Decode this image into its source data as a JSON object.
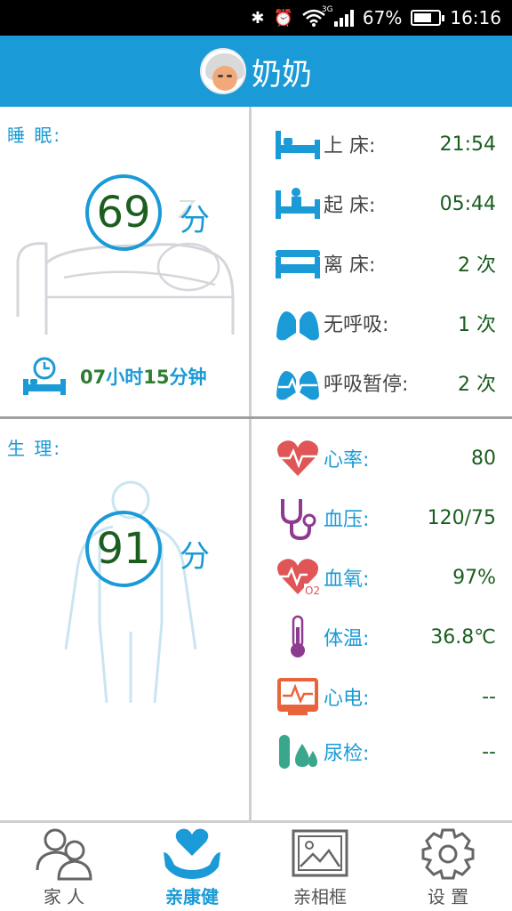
{
  "status_bar": {
    "battery": "67%",
    "time": "16:16",
    "network": "3G"
  },
  "header": {
    "title": "奶奶"
  },
  "sleep": {
    "label": "睡 眠:",
    "score": "69",
    "score_unit": "分",
    "total_hours": "07",
    "hours_unit": "小时",
    "total_minutes": "15",
    "minutes_unit": "分钟"
  },
  "sleep_stats": [
    {
      "icon": "bed-icon",
      "label": "上 床:",
      "value": "21:54",
      "unit": ""
    },
    {
      "icon": "get-up-icon",
      "label": "起 床:",
      "value": "05:44",
      "unit": ""
    },
    {
      "icon": "leave-bed-icon",
      "label": "离 床:",
      "value": "2",
      "unit": "次"
    },
    {
      "icon": "lungs-icon",
      "label": "无呼吸:",
      "value": "1",
      "unit": "次"
    },
    {
      "icon": "lungs-pulse-icon",
      "label": "呼吸暂停:",
      "value": "2",
      "unit": "次"
    }
  ],
  "physio": {
    "label": "生 理:",
    "score": "91",
    "score_unit": "分"
  },
  "physio_stats": [
    {
      "icon": "heart-rate-icon",
      "label": "心率:",
      "value": "80"
    },
    {
      "icon": "stethoscope-icon",
      "label": "血压:",
      "value": "120/75"
    },
    {
      "icon": "blood-oxygen-icon",
      "label": "血氧:",
      "value": "97%"
    },
    {
      "icon": "thermometer-icon",
      "label": "体温:",
      "value": "36.8℃"
    },
    {
      "icon": "ecg-icon",
      "label": "心电:",
      "value": "--"
    },
    {
      "icon": "urine-test-icon",
      "label": "尿检:",
      "value": "--"
    }
  ],
  "nav": [
    {
      "icon": "family-icon",
      "label": "家 人",
      "active": false
    },
    {
      "icon": "health-icon",
      "label": "亲康健",
      "active": true
    },
    {
      "icon": "photo-frame-icon",
      "label": "亲相框",
      "active": false
    },
    {
      "icon": "settings-gear-icon",
      "label": "设 置",
      "active": false
    }
  ],
  "colors": {
    "accent": "#1a9ad6",
    "value_green": "#1b5e20",
    "heart_red": "#e05555",
    "stethoscope_purple": "#8e3a8e",
    "ecg_orange": "#e9643a",
    "urine_teal": "#3aa68c"
  }
}
